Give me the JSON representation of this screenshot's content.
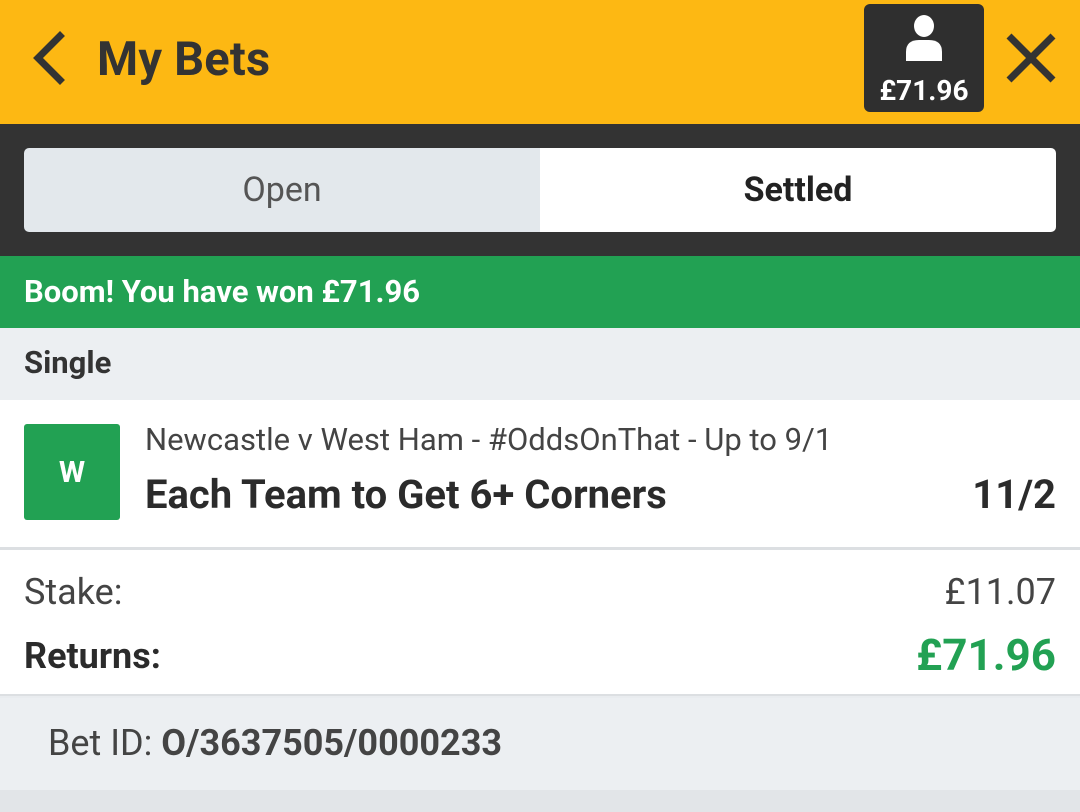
{
  "header": {
    "title": "My Bets",
    "back_icon": "chevron-left-icon",
    "account": {
      "icon": "person-icon",
      "balance": "£71.96"
    },
    "close_icon": "close-icon",
    "color": "#fdb813"
  },
  "tabs": [
    {
      "label": "Open",
      "active": false
    },
    {
      "label": "Settled",
      "active": true
    }
  ],
  "banner": {
    "text": "Boom! You have won £71.96",
    "color": "#22a153"
  },
  "bet": {
    "type": "Single",
    "result": "W",
    "event": "Newcastle v West Ham - #OddsOnThat - Up to 9/1",
    "selection": "Each Team to Get 6+ Corners",
    "odds": "11/2",
    "stake_label": "Stake:",
    "stake": "£11.07",
    "returns_label": "Returns:",
    "returns": "£71.96",
    "bet_id_label": "Bet ID: ",
    "bet_id": "O/3637505/0000233"
  }
}
